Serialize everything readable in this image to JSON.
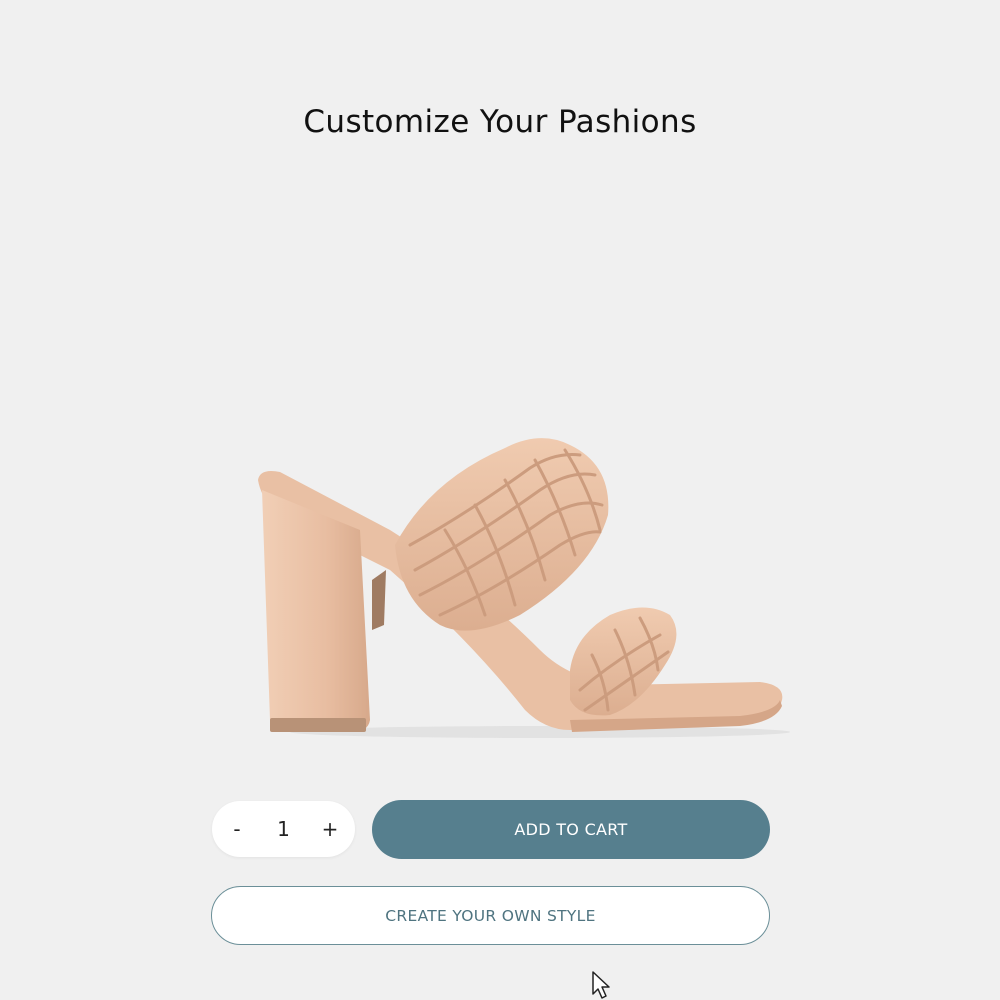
{
  "header": {
    "title": "Customize Your Pashions"
  },
  "product": {
    "image_icon": "braided-block-heel-sandal",
    "color": "#e8bda1"
  },
  "quantity": {
    "decrement_label": "-",
    "value": "1",
    "increment_label": "+"
  },
  "actions": {
    "add_to_cart_label": "ADD TO CART",
    "create_style_label": "CREATE YOUR OWN STYLE"
  },
  "colors": {
    "background": "#f0f0f0",
    "primary_button": "#567f8e",
    "outline_button_border": "#6b8f98",
    "outline_button_text": "#4f7480"
  },
  "cursor": {
    "icon": "mouse-pointer-icon"
  }
}
